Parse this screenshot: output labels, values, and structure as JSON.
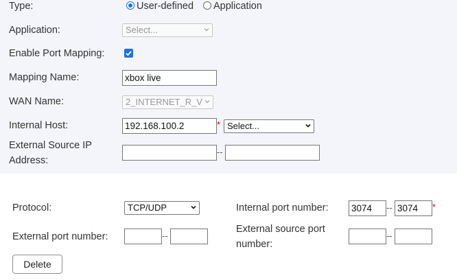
{
  "type": {
    "label": "Type:",
    "options": [
      "User-defined",
      "Application"
    ],
    "selected": "User-defined"
  },
  "application": {
    "label": "Application:",
    "value": "Select..."
  },
  "enable_port_mapping": {
    "label": "Enable Port Mapping:",
    "checked": true
  },
  "mapping_name": {
    "label": "Mapping Name:",
    "value": "xbox live"
  },
  "wan_name": {
    "label": "WAN Name:",
    "value": "2_INTERNET_R_V"
  },
  "internal_host": {
    "label": "Internal Host:",
    "value": "192.168.100.2",
    "required_mark": "*",
    "select_value": "Select..."
  },
  "external_source_ip": {
    "label_line1": "External Source IP",
    "label_line2": "Address:",
    "start": "",
    "end": "",
    "separator": "--"
  },
  "protocol": {
    "label": "Protocol:",
    "value": "TCP/UDP"
  },
  "internal_port": {
    "label": "Internal port number:",
    "start": "3074",
    "end": "3074",
    "separator": "--",
    "required_mark": "*"
  },
  "external_port": {
    "label": "External port number:",
    "start": "",
    "end": "",
    "separator": "--"
  },
  "external_source_port": {
    "label_line1": "External source port",
    "label_line2": "number:",
    "start": "",
    "end": "",
    "separator": "--"
  },
  "delete_button": {
    "label": "Delete"
  },
  "colors": {
    "accent": "#1a73e8",
    "panel_bg": "#f3f5fb",
    "required": "#e00000"
  }
}
